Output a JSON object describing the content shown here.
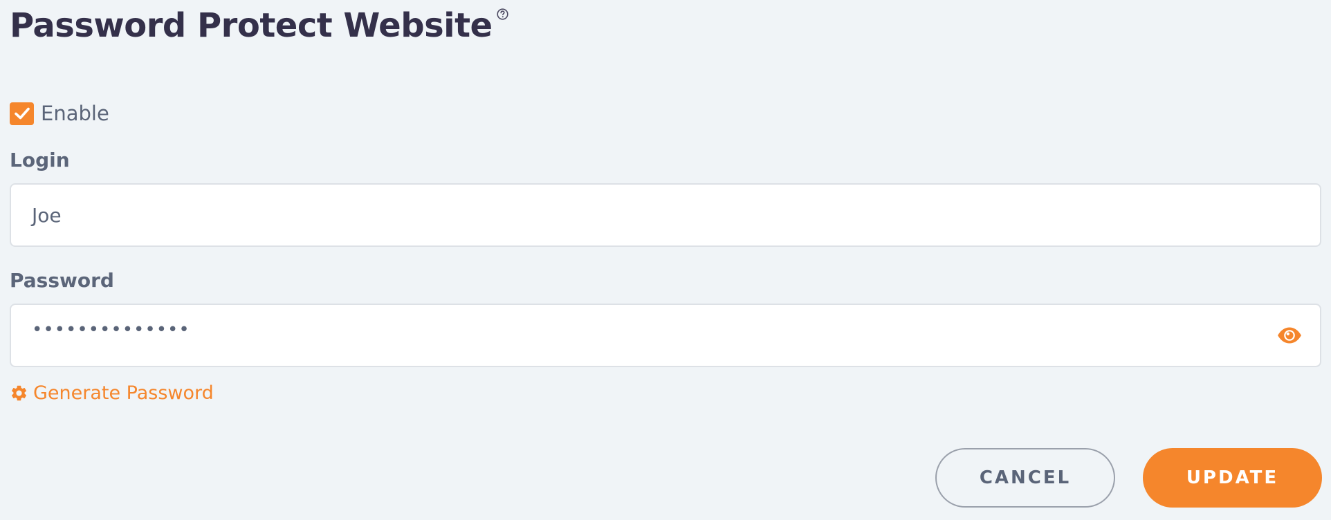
{
  "header": {
    "title": "Password Protect Website",
    "help_icon": "question-circle-icon"
  },
  "form": {
    "enable": {
      "label": "Enable",
      "checked": true
    },
    "login": {
      "label": "Login",
      "value": "Joe"
    },
    "password": {
      "label": "Password",
      "masked_value": "••••••••••••••",
      "toggle_icon": "eye-icon"
    },
    "generate": {
      "label": "Generate Password",
      "icon": "gear-icon"
    }
  },
  "actions": {
    "cancel_label": "CANCEL",
    "update_label": "UPDATE"
  },
  "colors": {
    "accent": "#f5862c",
    "title": "#34304a",
    "text": "#5a6478",
    "background": "#f0f4f7"
  }
}
